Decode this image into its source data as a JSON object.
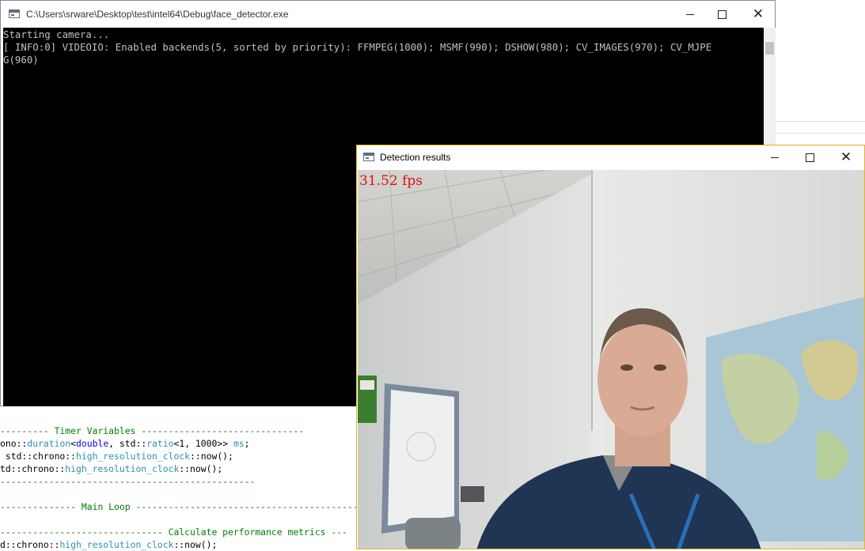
{
  "console": {
    "title": "C:\\Users\\srware\\Desktop\\test\\intel64\\Debug\\face_detector.exe",
    "lines": [
      "Starting camera...",
      "[ INFO:0] VIDEOIO: Enabled backends(5, sorted by priority): FFMPEG(1000); MSMF(990); DSHOW(980); CV_IMAGES(970); CV_MJPE",
      "G(960)"
    ]
  },
  "detection": {
    "title": "Detection results",
    "fps_label": "31.52 fps"
  },
  "editor": {
    "code_lines": [
      [
        {
          "t": "--------- Timer Variables ------------------------------",
          "c": "comment"
        }
      ],
      [
        {
          "t": "ono::",
          "c": "plain"
        },
        {
          "t": "duration",
          "c": "type"
        },
        {
          "t": "<",
          "c": "plain"
        },
        {
          "t": "double",
          "c": "kw"
        },
        {
          "t": ", std::",
          "c": "plain"
        },
        {
          "t": "ratio",
          "c": "type"
        },
        {
          "t": "<1, 1000>> ",
          "c": "plain"
        },
        {
          "t": "ms",
          "c": "type"
        },
        {
          "t": ";",
          "c": "plain"
        }
      ],
      [
        {
          "t": " std::chrono::",
          "c": "plain"
        },
        {
          "t": "high_resolution_clock",
          "c": "type"
        },
        {
          "t": "::now();",
          "c": "plain"
        }
      ],
      [
        {
          "t": "td::chrono::",
          "c": "plain"
        },
        {
          "t": "high_resolution_clock",
          "c": "type"
        },
        {
          "t": "::now();",
          "c": "plain"
        }
      ],
      [
        {
          "t": "-----------------------------------------------",
          "c": "comment"
        }
      ],
      [
        {
          "t": "",
          "c": "plain"
        }
      ],
      [
        {
          "t": "-------------- Main Loop ------------------------------------------",
          "c": "comment"
        }
      ],
      [
        {
          "t": "",
          "c": "plain"
        }
      ],
      [
        {
          "t": "------------------------------ Calculate performance metrics ---",
          "c": "comment"
        }
      ],
      [
        {
          "t": "d::chrono::",
          "c": "plain"
        },
        {
          "t": "high_resolution_clock",
          "c": "type"
        },
        {
          "t": "::now();",
          "c": "plain"
        }
      ]
    ]
  },
  "colors": {
    "console_bg": "#000000",
    "console_text": "#c0c0c0",
    "fps_text": "#e01010",
    "active_window_border": "#e6b422"
  }
}
